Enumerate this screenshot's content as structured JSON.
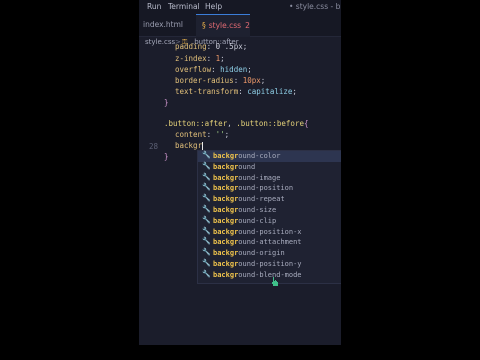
{
  "menu": {
    "items": [
      "Run",
      "Terminal",
      "Help"
    ],
    "window_title": "• style.css - button"
  },
  "tabs": [
    {
      "label": "index.html",
      "active": false
    },
    {
      "label": "style.css",
      "icon": "css-icon",
      "count": "2",
      "active": true
    }
  ],
  "breadcrumb": {
    "file": "style.css",
    "separator": ">",
    "symbol_icon": "selector-icon",
    "symbol": ".button::after"
  },
  "editor": {
    "lines": [
      {
        "num": "",
        "parts": [
          [
            "prop",
            "padding"
          ],
          [
            "punc",
            ": 0 .5px;"
          ]
        ]
      },
      {
        "num": "",
        "parts": [
          [
            "prop",
            "z-index"
          ],
          [
            "punc",
            ": "
          ],
          [
            "num",
            "1"
          ],
          [
            "punc",
            ";"
          ]
        ]
      },
      {
        "num": "",
        "parts": [
          [
            "prop",
            "overflow"
          ],
          [
            "punc",
            ": "
          ],
          [
            "val",
            "hidden"
          ],
          [
            "punc",
            ";"
          ]
        ]
      },
      {
        "num": "",
        "parts": [
          [
            "prop",
            "border-radius"
          ],
          [
            "punc",
            ": "
          ],
          [
            "num",
            "10px"
          ],
          [
            "punc",
            ";"
          ]
        ]
      },
      {
        "num": "",
        "parts": [
          [
            "prop",
            "text-transform"
          ],
          [
            "punc",
            ": "
          ],
          [
            "val",
            "capitalize"
          ],
          [
            "punc",
            ";"
          ]
        ]
      },
      {
        "num": "",
        "parts": [
          [
            "brace",
            "}"
          ]
        ]
      },
      {
        "num": "",
        "parts": []
      },
      {
        "num": "",
        "parts": [
          [
            "sel",
            ".button::after"
          ],
          [
            "punc",
            ", "
          ],
          [
            "sel",
            ".button::before"
          ],
          [
            "brace",
            "{"
          ]
        ]
      },
      {
        "num": "",
        "parts": [
          [
            "prop",
            "content"
          ],
          [
            "punc",
            ": "
          ],
          [
            "str",
            "''"
          ],
          [
            "punc",
            ";"
          ]
        ]
      },
      {
        "num": "28",
        "parts": [
          [
            "prop",
            "backgr"
          ]
        ]
      },
      {
        "num": "",
        "parts": [
          [
            "brace",
            "}"
          ]
        ]
      }
    ],
    "cursor_line": 9
  },
  "suggestions": {
    "typed": "backgr",
    "items": [
      "background-color",
      "background",
      "background-image",
      "background-position",
      "background-repeat",
      "background-size",
      "background-clip",
      "background-position-x",
      "background-attachment",
      "background-origin",
      "background-position-y",
      "background-blend-mode"
    ],
    "selected_index": 0
  },
  "colors": {
    "accent": "#3b7dd8",
    "match": "#f0c44c",
    "editor_bg": "#1b1d2b"
  },
  "icons": {
    "suggestion": "wrench-icon",
    "pointer": "mouse-pointer-icon"
  }
}
